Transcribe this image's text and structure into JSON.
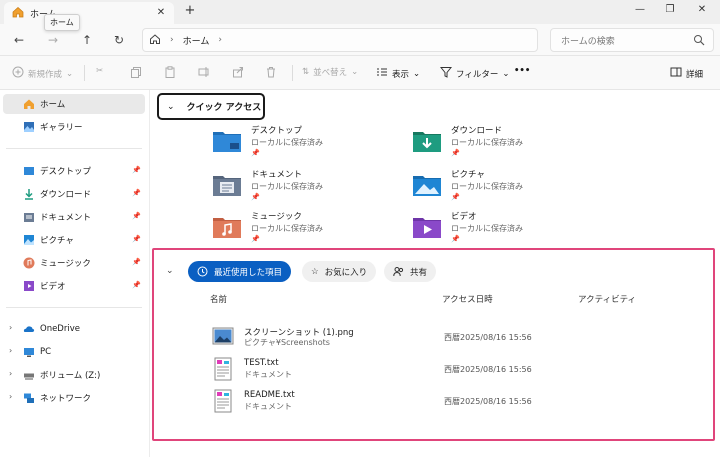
{
  "window": {
    "tab_title": "ホーム",
    "tooltip": "ホーム"
  },
  "address": {
    "crumb": "ホーム",
    "search_placeholder": "ホームの検索"
  },
  "commands": {
    "new": "新規作成",
    "sort": "並べ替え",
    "view": "表示",
    "filter": "フィルター",
    "more": "•••",
    "details": "詳細"
  },
  "sidebar": {
    "top": [
      {
        "label": "ホーム",
        "icon": "home-icon",
        "active": true
      },
      {
        "label": "ギャラリー",
        "icon": "gallery-icon"
      }
    ],
    "pinned": [
      {
        "label": "デスクトップ",
        "icon": "desktop-icon"
      },
      {
        "label": "ダウンロード",
        "icon": "download-icon"
      },
      {
        "label": "ドキュメント",
        "icon": "documents-icon"
      },
      {
        "label": "ピクチャ",
        "icon": "pictures-icon"
      },
      {
        "label": "ミュージック",
        "icon": "music-icon"
      },
      {
        "label": "ビデオ",
        "icon": "video-icon"
      }
    ],
    "locations": [
      {
        "label": "OneDrive",
        "icon": "onedrive-icon"
      },
      {
        "label": "PC",
        "icon": "pc-icon"
      },
      {
        "label": "ボリューム (Z:)",
        "icon": "drive-icon"
      },
      {
        "label": "ネットワーク",
        "icon": "network-icon"
      }
    ]
  },
  "quick_access": {
    "header": "クイック アクセス",
    "folders": [
      {
        "name": "デスクトップ",
        "sub": "ローカルに保存済み",
        "icon": "desktop-folder-icon",
        "color": "#2f88d8"
      },
      {
        "name": "ダウンロード",
        "sub": "ローカルに保存済み",
        "icon": "download-folder-icon",
        "color": "#1e9c80"
      },
      {
        "name": "ドキュメント",
        "sub": "ローカルに保存済み",
        "icon": "documents-folder-icon",
        "color": "#6b7c94"
      },
      {
        "name": "ピクチャ",
        "sub": "ローカルに保存済み",
        "icon": "pictures-folder-icon",
        "color": "#1f86d4"
      },
      {
        "name": "ミュージック",
        "sub": "ローカルに保存済み",
        "icon": "music-folder-icon",
        "color": "#e07a5a"
      },
      {
        "name": "ビデオ",
        "sub": "ローカルに保存済み",
        "icon": "video-folder-icon",
        "color": "#8a49c9"
      }
    ]
  },
  "recent": {
    "tabs": [
      "最近使用した項目",
      "お気に入り",
      "共有"
    ],
    "columns": [
      "名前",
      "アクセス日時",
      "アクティビティ"
    ],
    "files": [
      {
        "name": "スクリーンショット (1).png",
        "path": "ピクチャ¥Screenshots",
        "date": "西暦2025/08/16 15:56",
        "icon": "image-file-icon"
      },
      {
        "name": "TEST.txt",
        "path": "ドキュメント",
        "date": "西暦2025/08/16 15:56",
        "icon": "text-file-icon"
      },
      {
        "name": "README.txt",
        "path": "ドキュメント",
        "date": "西暦2025/08/16 15:56",
        "icon": "text-file-icon"
      }
    ]
  },
  "colors": {
    "accent": "#0a5fc2",
    "highlight_box": "#e0457b"
  }
}
